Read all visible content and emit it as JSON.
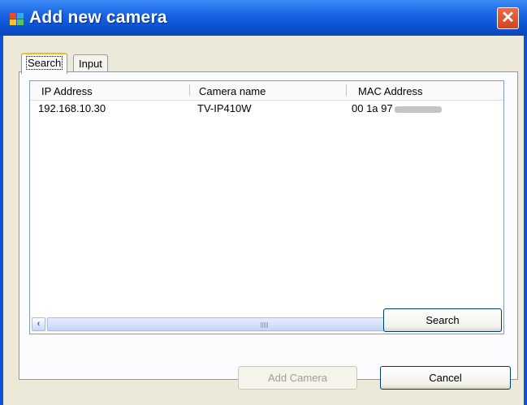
{
  "window": {
    "title": "Add new camera",
    "close_glyph": "✕"
  },
  "tabs": [
    {
      "label": "Search",
      "active": true
    },
    {
      "label": "Input",
      "active": false
    }
  ],
  "list": {
    "columns": [
      "IP Address",
      "Camera name",
      "MAC Address"
    ],
    "rows": [
      {
        "ip": "192.168.10.30",
        "name": "TV-IP410W",
        "mac": "00 1a 97"
      }
    ]
  },
  "scrollbar": {
    "left_icon": "‹",
    "right_icon": "›"
  },
  "buttons": {
    "search": "Search",
    "add_camera": "Add Camera",
    "cancel": "Cancel"
  }
}
